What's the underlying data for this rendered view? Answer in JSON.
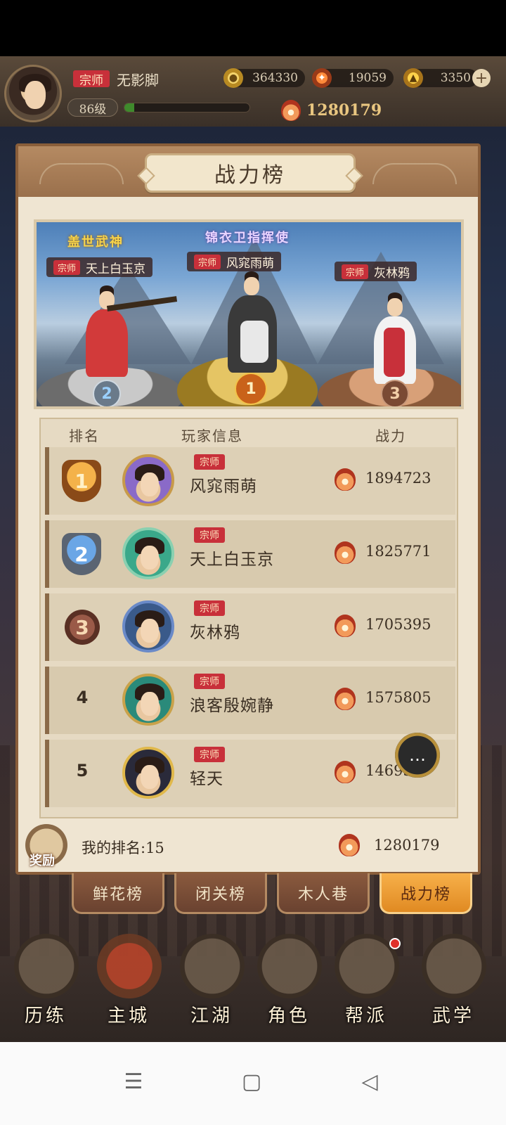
{
  "player": {
    "sect_title": "宗师",
    "name": "无影脚",
    "level": "86级",
    "exp_fraction": 0.08
  },
  "resources": {
    "coins": "364330",
    "gems": "19059",
    "ingots": "3350",
    "power": "1280179"
  },
  "panel": {
    "title": "战力榜"
  },
  "podium": {
    "first": {
      "honor": "锦衣卫指挥使",
      "sect": "宗师",
      "name": "风窕雨萌",
      "rank": "1"
    },
    "second": {
      "honor": "盖世武神",
      "sect": "宗师",
      "name": "天上白玉京",
      "rank": "2"
    },
    "third": {
      "sect": "宗师",
      "name": "灰林鸦",
      "rank": "3"
    }
  },
  "table": {
    "headers": {
      "rank": "排名",
      "info": "玩家信息",
      "power": "战力"
    },
    "rows": [
      {
        "rank": "1",
        "sect": "宗师",
        "name": "风窕雨萌",
        "power": "1894723"
      },
      {
        "rank": "2",
        "sect": "宗师",
        "name": "天上白玉京",
        "power": "1825771"
      },
      {
        "rank": "3",
        "sect": "宗师",
        "name": "灰林鸦",
        "power": "1705395"
      },
      {
        "rank": "4",
        "sect": "宗师",
        "name": "浪客殷婉静",
        "power": "1575805"
      },
      {
        "rank": "5",
        "sect": "宗师",
        "name": "轻天",
        "power": "14693"
      }
    ]
  },
  "my_rank": {
    "reward_label": "奖励",
    "rank_text": "我的排名:15",
    "power": "1280179"
  },
  "tabs": [
    "鲜花榜",
    "闭关榜",
    "木人巷",
    "战力榜"
  ],
  "nav": [
    "历练",
    "主城",
    "江湖",
    "角色",
    "帮派",
    "武学"
  ],
  "system_nav": {
    "menu": "☰",
    "home": "▢",
    "back": "◁"
  },
  "icons": {
    "chat": "chat-bubble-icon"
  },
  "colors": {
    "accent": "#e08a22",
    "sect_badge": "#c8303a",
    "panel_bg": "#efe5d2"
  }
}
